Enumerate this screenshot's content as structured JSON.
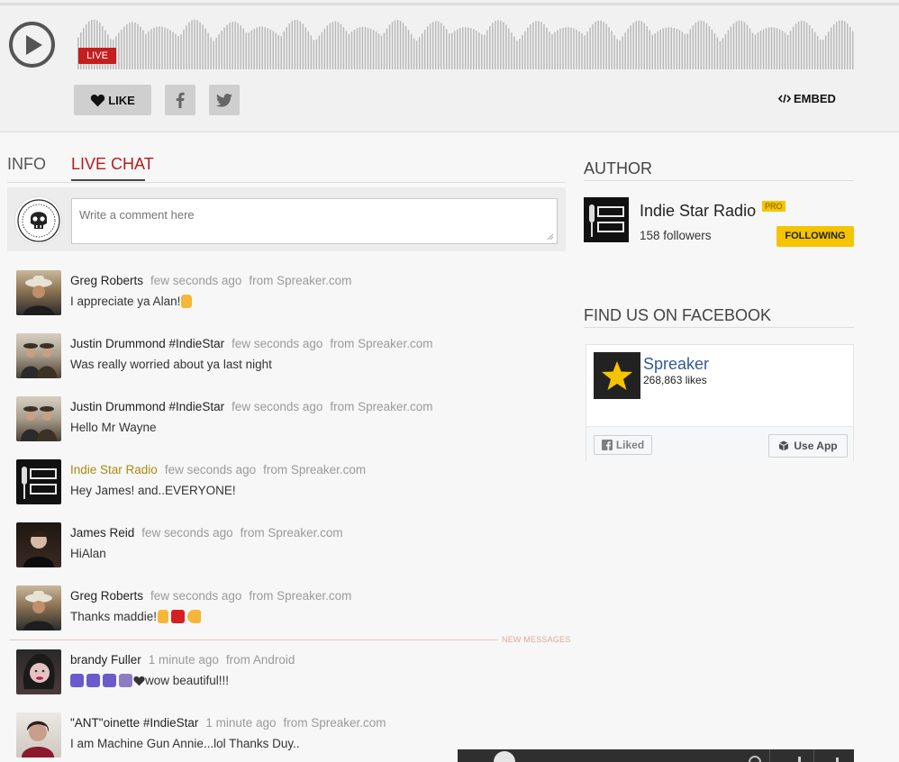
{
  "player": {
    "live_label": "LIVE",
    "like_label": "LIKE",
    "embed_label": "EMBED"
  },
  "tabs": [
    {
      "label": "INFO",
      "active": false
    },
    {
      "label": "LIVE CHAT",
      "active": true
    }
  ],
  "comment": {
    "placeholder": "Write a comment here"
  },
  "messages": [
    {
      "name": "Greg Roberts",
      "time": "few seconds ago",
      "source": "from Spreaker.com",
      "text": "I appreciate ya Alan!",
      "emojis": [
        "raised-hand"
      ]
    },
    {
      "name": "Justin Drummond #IndieStar",
      "time": "few seconds ago",
      "source": "from Spreaker.com",
      "text": "Was really worried about ya last night",
      "emojis": []
    },
    {
      "name": "Justin Drummond #IndieStar",
      "time": "few seconds ago",
      "source": "from Spreaker.com",
      "text": "Hello Mr Wayne",
      "emojis": []
    },
    {
      "name": "Indie Star Radio",
      "time": "few seconds ago",
      "source": "from Spreaker.com",
      "text": "Hey James! and..EVERYONE!",
      "emojis": [],
      "is_author": true
    },
    {
      "name": "James Reid",
      "time": "few seconds ago",
      "source": "from Spreaker.com",
      "text": "HiAlan",
      "emojis": []
    },
    {
      "name": "Greg Roberts",
      "time": "few seconds ago",
      "source": "from Spreaker.com",
      "text": "Thanks maddie!",
      "emojis": [
        "raised-hand",
        "100",
        "flexed-arm"
      ]
    },
    {
      "name": "brandy Fuller",
      "time": "1 minute ago",
      "source": "from Android",
      "text": "wow beautiful!!!",
      "emojis_before": [
        "music-notes",
        "music-notes",
        "music-notes",
        "music-note",
        "black-heart"
      ]
    },
    {
      "name": "\"ANT\"oinette #IndieStar",
      "time": "1 minute ago",
      "source": "from Spreaker.com",
      "text": "I am Machine Gun Annie...lol Thanks Duy..",
      "emojis": []
    }
  ],
  "new_messages_label": "NEW MESSAGES",
  "author": {
    "section_title": "AUTHOR",
    "name": "Indie Star Radio",
    "pro_badge": "PRO",
    "followers": "158 followers",
    "following_label": "FOLLOWING"
  },
  "facebook": {
    "section_title": "FIND US ON FACEBOOK",
    "page_name": "Spreaker",
    "likes": "268,863 likes",
    "liked_label": "Liked",
    "use_app_label": "Use App"
  },
  "colors": {
    "accent_red": "#b71c1c",
    "live_red": "#c41e1e",
    "author_gold": "#a88a10",
    "follow_yellow": "#f5c400",
    "fb_blue": "#365899"
  }
}
